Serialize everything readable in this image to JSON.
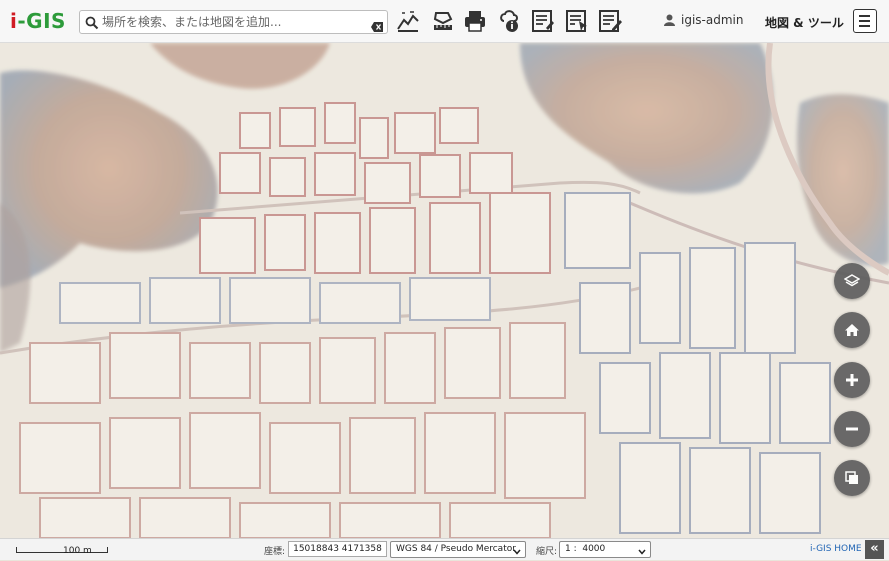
{
  "app": {
    "logo_i": "i",
    "logo_rest": "-GIS"
  },
  "search": {
    "placeholder": "場所を検索、または地図を追加..."
  },
  "toolbar": {
    "icons": [
      "profile-chart-icon",
      "measure-area-icon",
      "print-icon",
      "info-query-icon",
      "report-icon",
      "select-report-icon",
      "edit-report-icon"
    ]
  },
  "user": {
    "name": "igis-admin"
  },
  "map_tools": {
    "label": "地図 & ツール"
  },
  "controls": [
    "layers-icon",
    "home-icon",
    "zoom-in-icon",
    "zoom-out-icon",
    "basemap-icon"
  ],
  "footer": {
    "scale_bar": "100 m",
    "coord_label": "座標:",
    "coord_value": "15018843 4171358",
    "projection": "WGS 84 / Pseudo Mercator",
    "scale_label": "縮尺:",
    "scale_value": "1 :  4000",
    "home_link": "i-GIS HOME",
    "collapse": "«"
  },
  "colors": {
    "logo_i": "#d01c24",
    "logo_gis": "#2d9b3a",
    "link": "#2366b5",
    "control_bg": "#5e5e5e"
  }
}
